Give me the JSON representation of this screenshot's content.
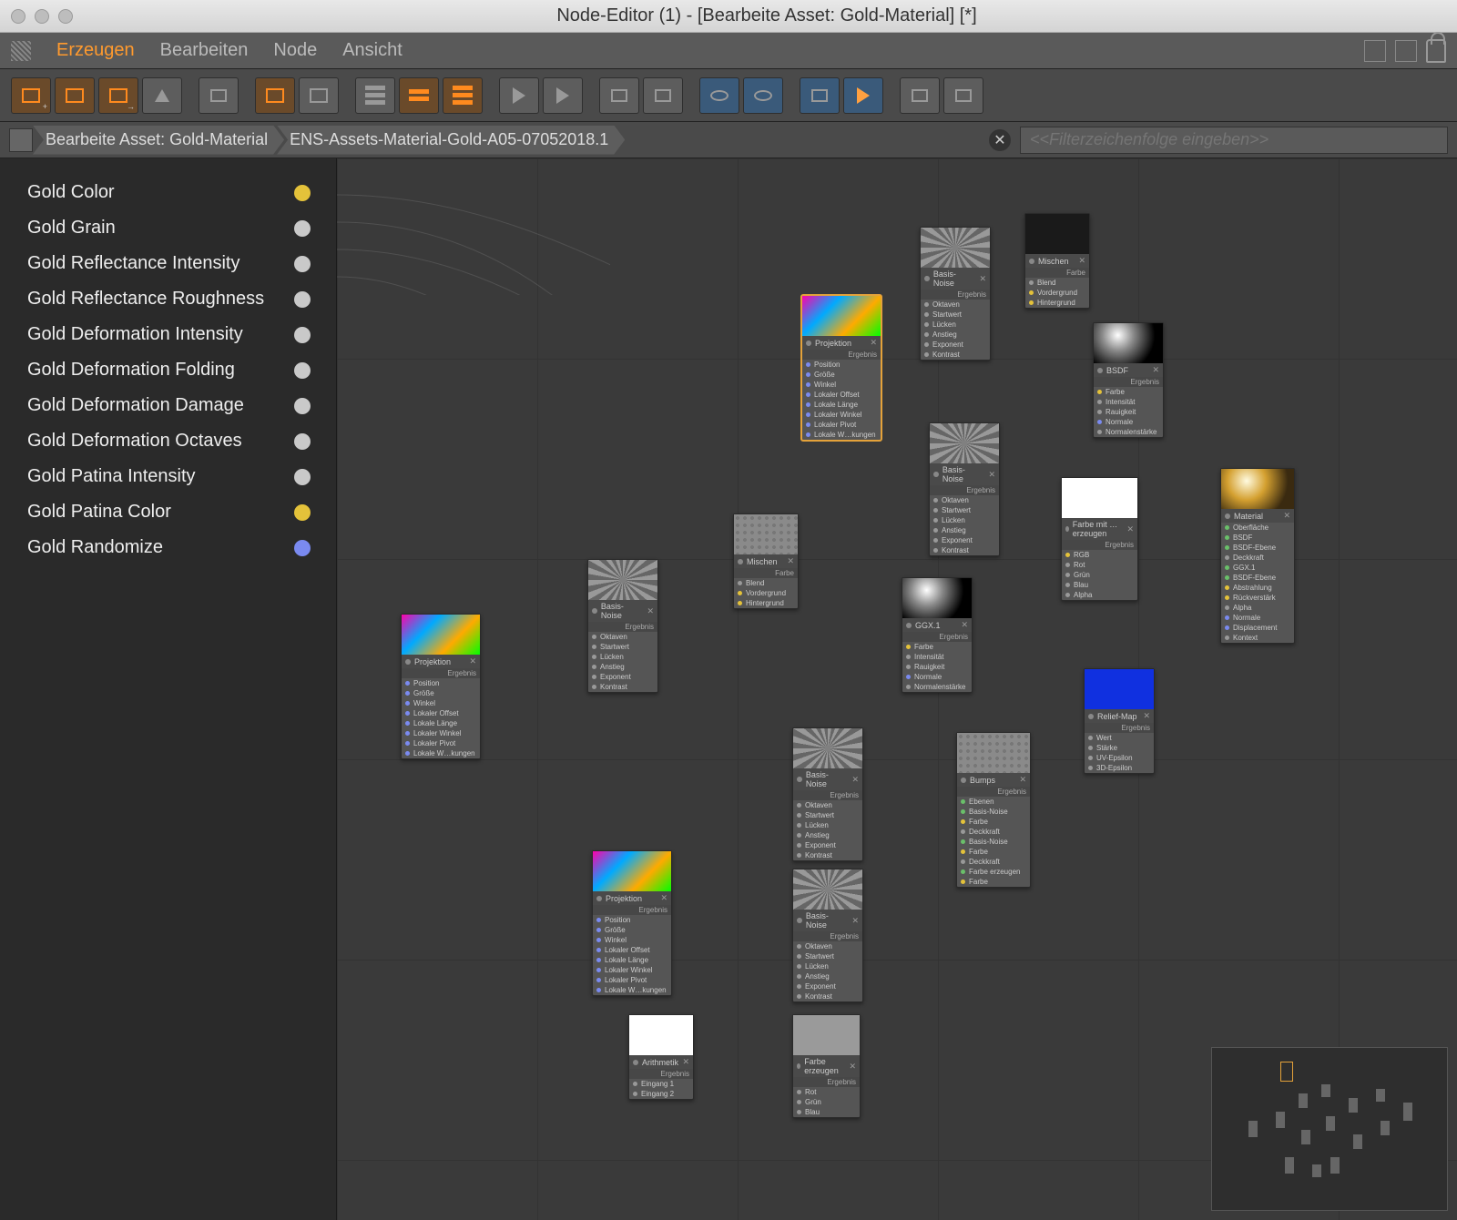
{
  "window": {
    "title": "Node-Editor (1) - [Bearbeite Asset: Gold-Material] [*]"
  },
  "menu": {
    "items": [
      "Erzeugen",
      "Bearbeiten",
      "Node",
      "Ansicht"
    ],
    "active_index": 0
  },
  "breadcrumb": {
    "items": [
      "Bearbeite Asset: Gold-Material",
      "ENS-Assets-Material-Gold-A05-07052018.1"
    ],
    "filter_placeholder": "<<Filterzeichenfolge eingeben>>"
  },
  "sidebar": {
    "items": [
      {
        "label": "Gold Color",
        "swatch": "gold"
      },
      {
        "label": "Gold Grain",
        "swatch": "grey"
      },
      {
        "label": "Gold Reflectance Intensity",
        "swatch": "grey"
      },
      {
        "label": "Gold Reflectance Roughness",
        "swatch": "grey"
      },
      {
        "label": "Gold Deformation Intensity",
        "swatch": "grey"
      },
      {
        "label": "Gold Deformation Folding",
        "swatch": "grey"
      },
      {
        "label": "Gold Deformation Damage",
        "swatch": "grey"
      },
      {
        "label": "Gold Deformation Octaves",
        "swatch": "grey"
      },
      {
        "label": "Gold Patina Intensity",
        "swatch": "grey"
      },
      {
        "label": "Gold Patina Color",
        "swatch": "gold"
      },
      {
        "label": "Gold Randomize",
        "swatch": "blue"
      }
    ]
  },
  "nodes": {
    "projektion1": {
      "title": "Projektion",
      "section": "Ergebnis",
      "rows": [
        "Position",
        "Größe",
        "Winkel",
        "Lokaler Offset",
        "Lokale Länge",
        "Lokaler Winkel",
        "Lokaler Pivot",
        "Lokale W…kungen"
      ]
    },
    "projektion2": {
      "title": "Projektion",
      "section": "Ergebnis",
      "rows": [
        "Position",
        "Größe",
        "Winkel",
        "Lokaler Offset",
        "Lokale Länge",
        "Lokaler Winkel",
        "Lokaler Pivot",
        "Lokale W…kungen"
      ]
    },
    "projektion3": {
      "title": "Projektion",
      "section": "Ergebnis",
      "rows": [
        "Position",
        "Größe",
        "Winkel",
        "Lokaler Offset",
        "Lokale Länge",
        "Lokaler Winkel",
        "Lokaler Pivot",
        "Lokale W…kungen"
      ]
    },
    "basisnoise1": {
      "title": "Basis-Noise",
      "section": "Ergebnis",
      "rows": [
        "Oktaven",
        "Startwert",
        "Lücken",
        "Anstieg",
        "Exponent",
        "Kontrast"
      ]
    },
    "basisnoise2": {
      "title": "Basis-Noise",
      "section": "Ergebnis",
      "rows": [
        "Oktaven",
        "Startwert",
        "Lücken",
        "Anstieg",
        "Exponent",
        "Kontrast"
      ]
    },
    "basisnoise3": {
      "title": "Basis-Noise",
      "section": "Ergebnis",
      "rows": [
        "Oktaven",
        "Startwert",
        "Lücken",
        "Anstieg",
        "Exponent",
        "Kontrast"
      ]
    },
    "basisnoise4": {
      "title": "Basis-Noise",
      "section": "Ergebnis",
      "rows": [
        "Oktaven",
        "Startwert",
        "Lücken",
        "Anstieg",
        "Exponent",
        "Kontrast"
      ]
    },
    "basisnoise5": {
      "title": "Basis-Noise",
      "section": "Ergebnis",
      "rows": [
        "Oktaven",
        "Startwert",
        "Lücken",
        "Anstieg",
        "Exponent",
        "Kontrast"
      ]
    },
    "mischen1": {
      "title": "Mischen",
      "section": "Farbe",
      "rows": [
        "Blend",
        "Vordergrund",
        "Hintergrund"
      ]
    },
    "mischen2": {
      "title": "Mischen",
      "section": "Farbe",
      "rows": [
        "Blend",
        "Vordergrund",
        "Hintergrund"
      ]
    },
    "arithmetik": {
      "title": "Arithmetik",
      "section": "Ergebnis",
      "rows": [
        "Eingang 1",
        "Eingang 2"
      ]
    },
    "farbeerzeugen": {
      "title": "Farbe erzeugen",
      "section": "Ergebnis",
      "rows": [
        "Rot",
        "Grün",
        "Blau"
      ]
    },
    "farbemit": {
      "title": "Farbe mit … erzeugen",
      "section": "Ergebnis",
      "rows": [
        "RGB",
        "Rot",
        "Grün",
        "Blau",
        "Alpha"
      ]
    },
    "bsdf": {
      "title": "BSDF",
      "section": "Ergebnis",
      "rows": [
        "Farbe",
        "Intensität",
        "Rauigkeit",
        "Normale",
        "Normalenstärke"
      ]
    },
    "ggx": {
      "title": "GGX.1",
      "section": "Ergebnis",
      "rows": [
        "Farbe",
        "Intensität",
        "Rauigkeit",
        "Normale",
        "Normalenstärke"
      ]
    },
    "bumps": {
      "title": "Bumps",
      "section": "Ergebnis",
      "rows": [
        "Ebenen",
        "Basis-Noise",
        "Farbe",
        "Deckkraft",
        "Basis-Noise",
        "Farbe",
        "Deckkraft",
        "Farbe erzeugen",
        "Farbe"
      ]
    },
    "reliefmap": {
      "title": "Relief-Map",
      "section": "Ergebnis",
      "rows": [
        "Wert",
        "Stärke",
        "UV-Epsilon",
        "3D-Epsilon"
      ]
    },
    "material": {
      "title": "Material",
      "rows": [
        "Oberfläche",
        "BSDF",
        "BSDF-Ebene",
        "Deckkraft",
        "GGX.1",
        "BSDF-Ebene",
        "Abstrahlung",
        "Rückverstärk",
        "Alpha",
        "Normale",
        "Displacement",
        "Kontext"
      ]
    }
  }
}
